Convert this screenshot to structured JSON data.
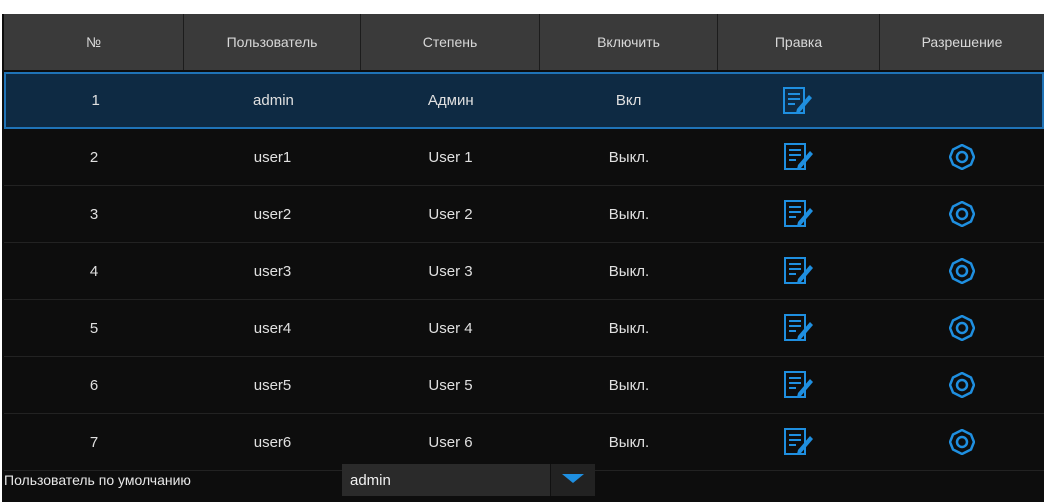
{
  "table": {
    "headers": [
      "№",
      "Пользователь",
      "Степень",
      "Включить",
      "Правка",
      "Разрешение"
    ],
    "rows": [
      {
        "no": "1",
        "user": "admin",
        "level": "Админ",
        "enabled": "Вкл",
        "has_permission": false
      },
      {
        "no": "2",
        "user": "user1",
        "level": "User 1",
        "enabled": "Выкл.",
        "has_permission": true
      },
      {
        "no": "3",
        "user": "user2",
        "level": "User 2",
        "enabled": "Выкл.",
        "has_permission": true
      },
      {
        "no": "4",
        "user": "user3",
        "level": "User 3",
        "enabled": "Выкл.",
        "has_permission": true
      },
      {
        "no": "5",
        "user": "user4",
        "level": "User 4",
        "enabled": "Выкл.",
        "has_permission": true
      },
      {
        "no": "6",
        "user": "user5",
        "level": "User 5",
        "enabled": "Выкл.",
        "has_permission": true
      },
      {
        "no": "7",
        "user": "user6",
        "level": "User 6",
        "enabled": "Выкл.",
        "has_permission": true
      }
    ],
    "selected_row": 0
  },
  "icons": {
    "edit": "edit-icon",
    "permission": "gear-icon",
    "dropdown": "chevron-down-icon"
  },
  "footer": {
    "default_user_label": "Пользователь по умолчанию",
    "default_user_value": "admin"
  },
  "colors": {
    "accent": "#1f8fe0",
    "selected_row_bg": "#0e2a43",
    "selected_row_border": "#1f73b7",
    "header_bg": "#3a3a3a",
    "panel_bg": "#0d0d0d"
  }
}
